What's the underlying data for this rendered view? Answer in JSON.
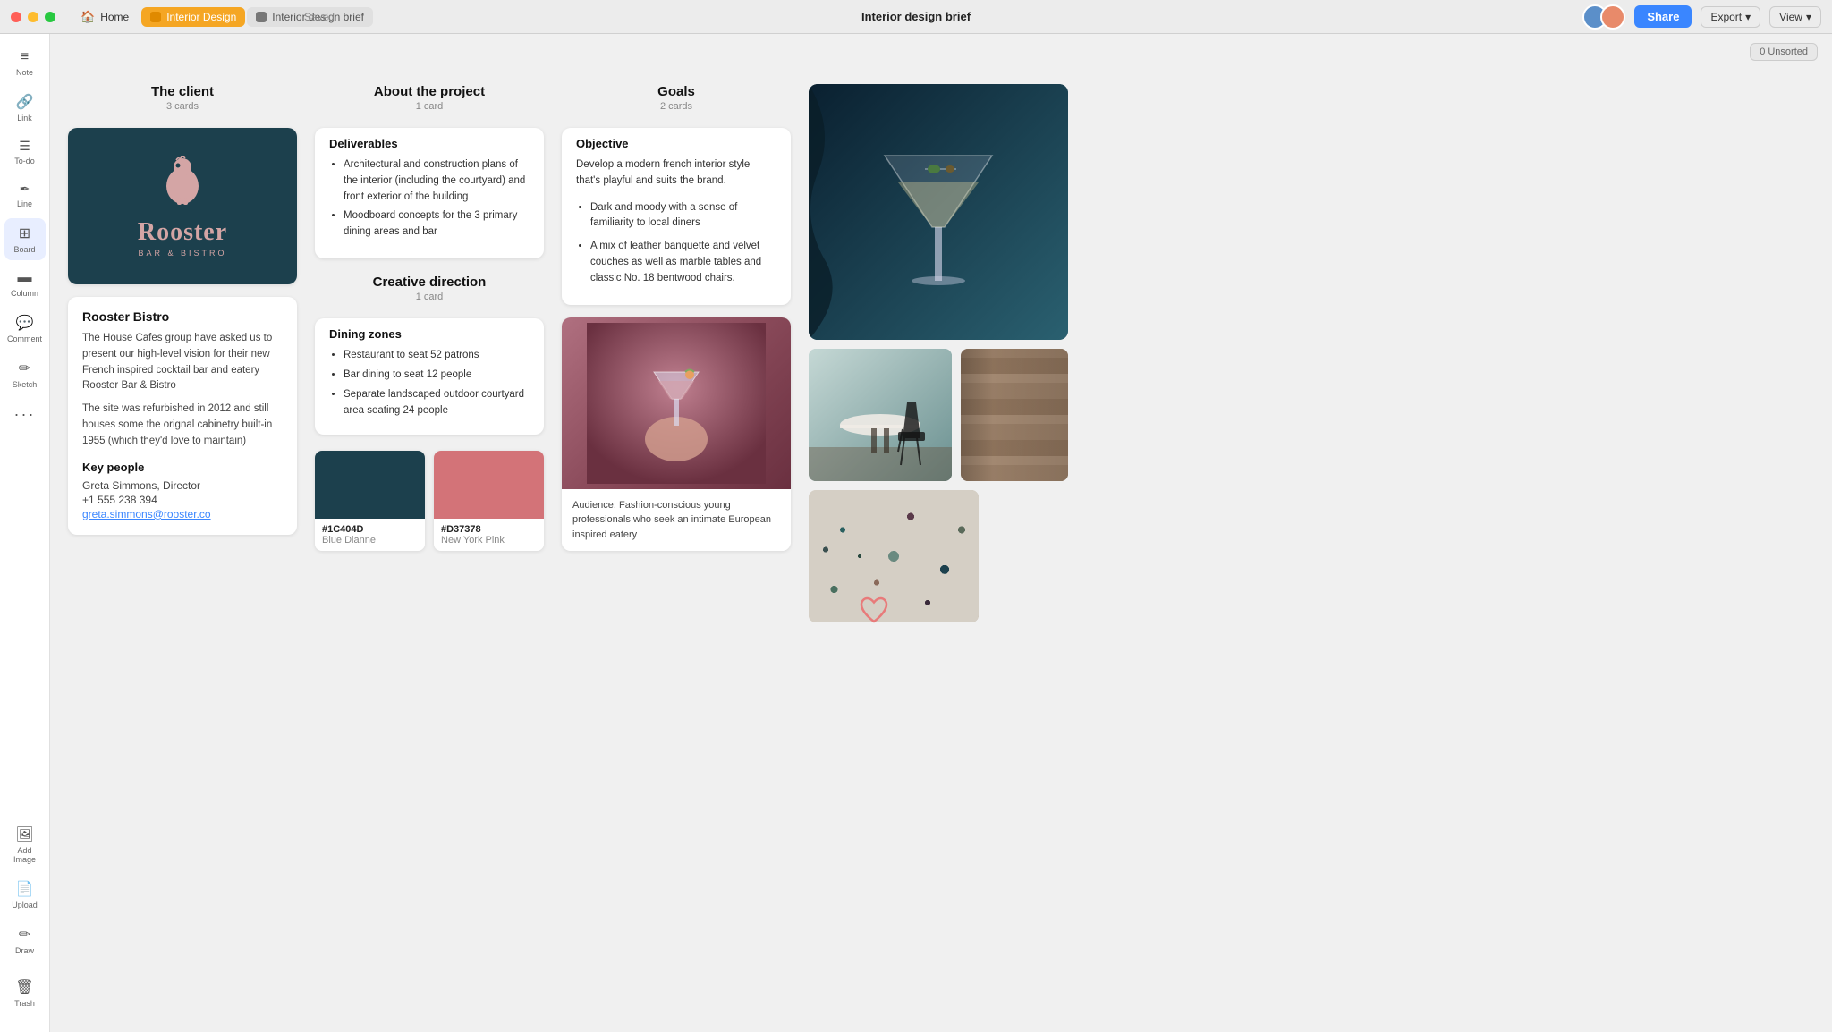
{
  "titlebar": {
    "saved_label": "Saved",
    "title": "Interior design brief",
    "tabs": [
      {
        "id": "home",
        "label": "Home",
        "icon": "home-icon"
      },
      {
        "id": "interior",
        "label": "Interior Design",
        "icon": "interior-icon"
      },
      {
        "id": "brief",
        "label": "Interior design brief",
        "icon": "brief-icon"
      }
    ],
    "actions": {
      "share": "Share",
      "export": "Export",
      "export_arrow": "▾",
      "view": "View",
      "view_arrow": "▾",
      "unsorted": "0 Unsorted"
    }
  },
  "sidebar": {
    "items": [
      {
        "id": "note",
        "label": "Note",
        "icon": "≡"
      },
      {
        "id": "link",
        "label": "Link",
        "icon": "🔗"
      },
      {
        "id": "todo",
        "label": "To-do",
        "icon": "☰"
      },
      {
        "id": "line",
        "label": "Line",
        "icon": "✏"
      },
      {
        "id": "board",
        "label": "Board",
        "icon": "⊞"
      },
      {
        "id": "column",
        "label": "Column",
        "icon": "▬"
      },
      {
        "id": "comment",
        "label": "Comment",
        "icon": "💬"
      },
      {
        "id": "sketch",
        "label": "Sketch",
        "icon": "✏"
      },
      {
        "id": "more",
        "label": "...",
        "icon": "•••"
      }
    ],
    "bottom": [
      {
        "id": "add-image",
        "label": "Add Image",
        "icon": "🖼"
      },
      {
        "id": "upload",
        "label": "Upload",
        "icon": "📄"
      },
      {
        "id": "draw",
        "label": "Draw",
        "icon": "✏"
      },
      {
        "id": "trash",
        "label": "Trash",
        "icon": "🗑"
      }
    ]
  },
  "columns": {
    "client": {
      "title": "The client",
      "count": "3 cards",
      "logo": {
        "name": "Rooster",
        "sub": "BAR & BISTRO"
      },
      "bistro_name": "Rooster Bistro",
      "desc1": "The House Cafes group have asked us to present our high-level vision for their new French inspired cocktail bar and eatery Rooster Bar & Bistro",
      "desc2": "The site was refurbished in 2012 and still houses some the orignal cabinetry built-in 1955 (which they'd love to maintain)",
      "key_people_title": "Key people",
      "key_people_name": "Greta Simmons, Director",
      "key_people_phone": "+1 555 238 394",
      "key_people_email": "greta.simmons@rooster.co"
    },
    "about": {
      "title": "About the project",
      "count": "1 card",
      "deliverables_title": "Deliverables",
      "deliverables": [
        "Architectural and construction plans of the interior (including the courtyard) and front exterior of the building",
        "Moodboard concepts for the 3 primary dining areas and bar"
      ],
      "creative_title": "Creative direction",
      "creative_count": "1 card",
      "dining_title": "Dining zones",
      "dining_items": [
        "Restaurant to seat 52 patrons",
        "Bar dining to seat 12 people",
        "Separate landscaped outdoor courtyard area seating 24 people"
      ],
      "colors": [
        {
          "hex": "#1C404D",
          "name": "Blue Dianne",
          "display": "#1C404D"
        },
        {
          "hex": "#D37378",
          "name": "New York Pink",
          "display": "#D37378"
        }
      ]
    },
    "goals": {
      "title": "Goals",
      "count": "2 cards",
      "objective_title": "Objective",
      "objective_text": "Develop a modern french interior style that's playful and suits the brand.",
      "goals_items": [
        "Dark and moody with a sense of familiarity to local diners",
        "A mix of leather banquette and velvet couches as well as marble tables and classic No. 18 bentwood chairs."
      ],
      "audience_caption": "Audience: Fashion-conscious young professionals who seek an intimate European inspired eatery"
    }
  }
}
